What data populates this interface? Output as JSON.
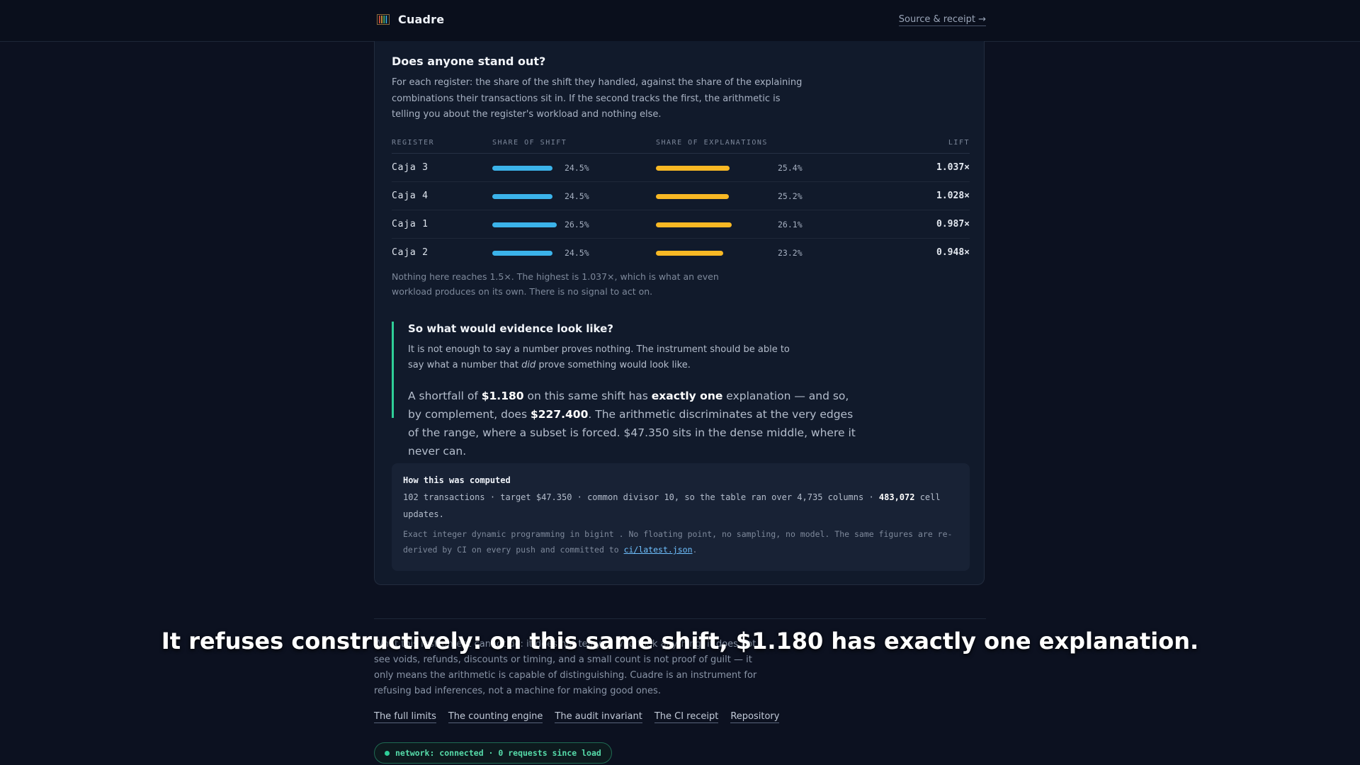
{
  "header": {
    "brand": "Cuadre",
    "logo_icon": "abacus-icon",
    "link": "Source & receipt →"
  },
  "card": {
    "title": "Does anyone stand out?",
    "description": "For each register: the share of the shift they handled, against the share of the explaining combinations their transactions sit in. If the second tracks the first, the arithmetic is telling you about the register's workload and nothing else.",
    "columns": [
      "REGISTER",
      "SHARE OF SHIFT",
      "SHARE OF EXPLANATIONS",
      "LIFT"
    ],
    "rows": [
      {
        "register": "Caja 3",
        "shift": "24.5%",
        "shift_value": 24.5,
        "expl": "25.4%",
        "expl_value": 25.4,
        "lift": "1.037×"
      },
      {
        "register": "Caja 4",
        "shift": "24.5%",
        "shift_value": 24.5,
        "expl": "25.2%",
        "expl_value": 25.2,
        "lift": "1.028×"
      },
      {
        "register": "Caja 1",
        "shift": "26.5%",
        "shift_value": 26.5,
        "expl": "26.1%",
        "expl_value": 26.1,
        "lift": "0.987×"
      },
      {
        "register": "Caja 2",
        "shift": "24.5%",
        "shift_value": 24.5,
        "expl": "23.2%",
        "expl_value": 23.2,
        "lift": "0.948×"
      }
    ],
    "note": "Nothing here reaches 1.5×. The highest is 1.037×, which is what an even workload produces on its own. There is no signal to act on."
  },
  "callout": {
    "title": "So what would evidence look like?",
    "p1_a": "It is not enough to say a number proves nothing. The instrument should be able to say what a number that ",
    "p1_em": "did",
    "p1_b": " prove something would look like.",
    "p2_a": "A shortfall of ",
    "p2_amount1": "$1.180",
    "p2_b": " on this same shift has ",
    "p2_strong": "exactly one",
    "p2_c": " explanation — and so, by complement, does ",
    "p2_amount2": "$227.400",
    "p2_d": ". The arithmetic discriminates at the very edges of the range, where a subset is forced. $47.350 sits in the dense middle, where it never can."
  },
  "computed": {
    "title": "How this was computed",
    "line_a": "102 transactions · target $47.350 · common divisor 10, so the table ran over 4,735 columns · ",
    "line_bold": "483,072",
    "line_b": " cell updates.",
    "small_a": "Exact integer dynamic programming in  bigint . No floating point, no sampling, no model. The same figures are re-derived by CI on every push and committed to ",
    "small_link": "ci/latest.json",
    "small_b": "."
  },
  "lower": {
    "paragraph": "What this instrument cannot do: it does not tell you who took anything, it does not see voids, refunds, discounts or timing, and a small count is not proof of guilt — it only means the arithmetic is capable of distinguishing. Cuadre is an instrument for refusing bad inferences, not a machine for making good ones.",
    "links": [
      "The full limits",
      "The counting engine",
      "The audit invariant",
      "The CI receipt",
      "Repository"
    ]
  },
  "status": {
    "text": "network: connected · 0 requests since load",
    "color": "#2fcf98"
  },
  "caption": "It refuses constructively: on this same shift, $1.180 has exactly one explanation.",
  "colors": {
    "shift_bar": "#3bb3ea",
    "expl_bar": "#f8b824",
    "accent": "#2fcf98"
  }
}
